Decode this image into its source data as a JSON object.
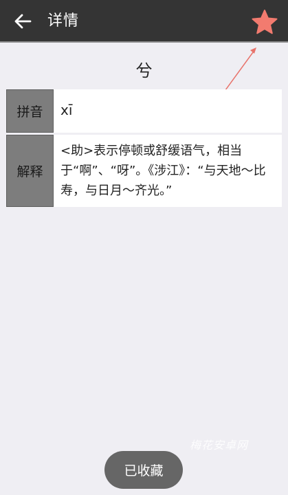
{
  "header": {
    "back_icon": "arrow-left-icon",
    "title": "详情",
    "favorite_icon": "star-icon",
    "favorite_color": "#f27b6f"
  },
  "entry": {
    "character": "兮",
    "pinyin_label": "拼音",
    "pinyin_value": "xī",
    "meaning_label": "解释",
    "meaning_value": "<助>表示停顿或舒缓语气，相当于“啊”、“呀”。《涉江》：“与天地～比寿，与日月～齐光。”"
  },
  "toast": {
    "text": "已收藏"
  },
  "watermark": {
    "text": "梅花安卓网"
  },
  "colors": {
    "app_bar": "#343434",
    "background": "#efeef3",
    "annotation_arrow": "#e8736b"
  }
}
